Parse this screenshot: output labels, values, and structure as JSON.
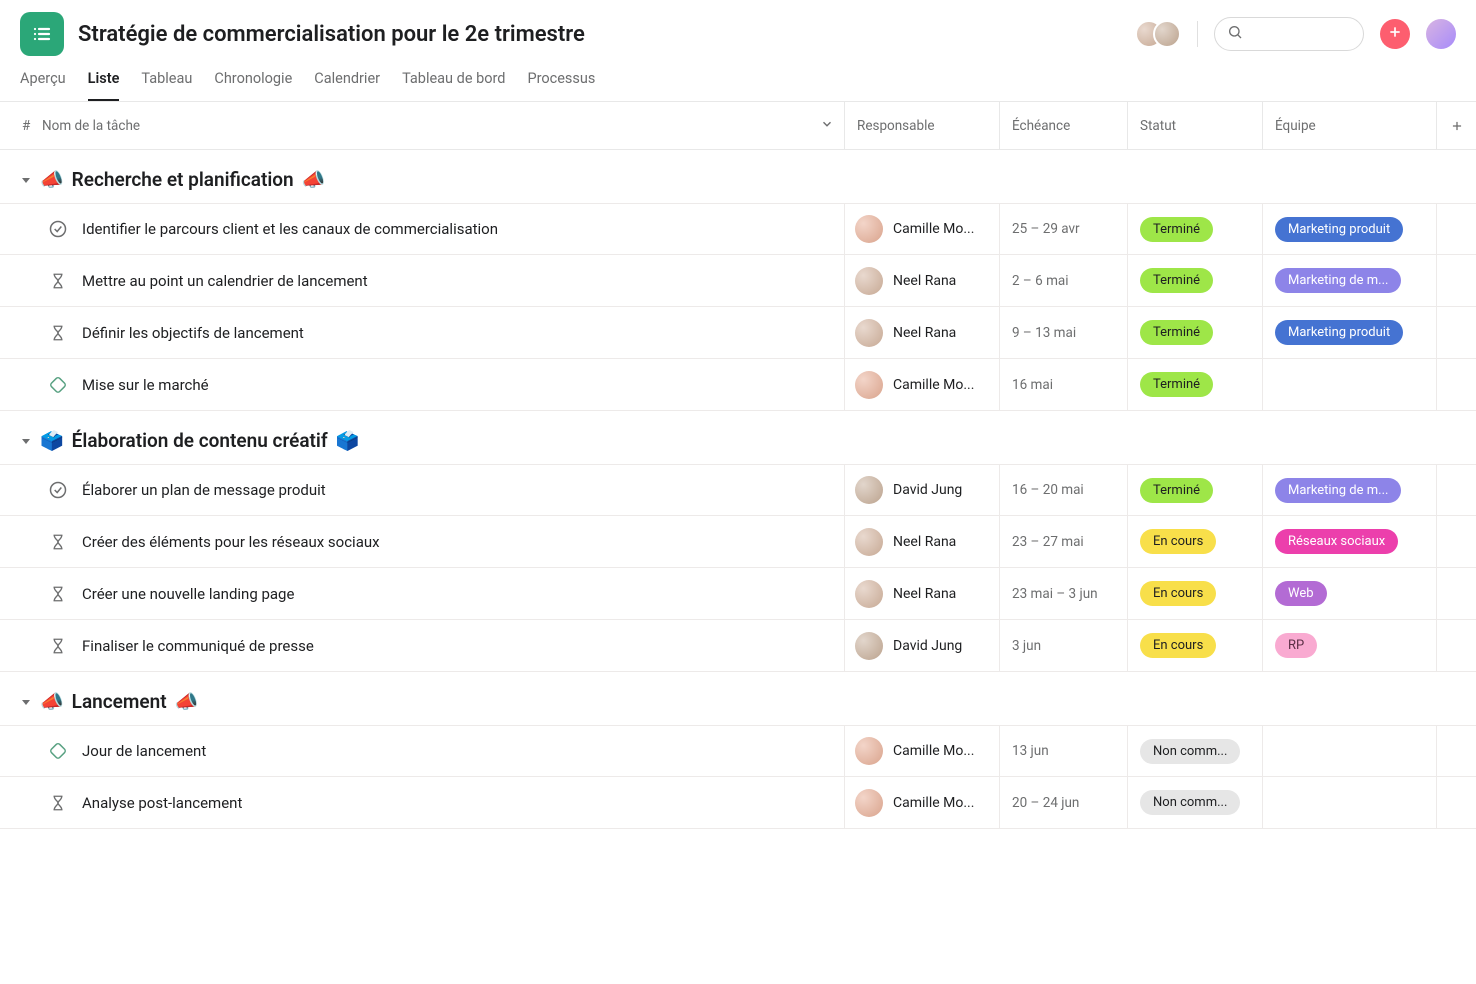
{
  "project": {
    "title": "Stratégie de commercialisation pour le 2e trimestre"
  },
  "tabs": [
    {
      "label": "Aperçu",
      "active": false
    },
    {
      "label": "Liste",
      "active": true
    },
    {
      "label": "Tableau",
      "active": false
    },
    {
      "label": "Chronologie",
      "active": false
    },
    {
      "label": "Calendrier",
      "active": false
    },
    {
      "label": "Tableau de bord",
      "active": false
    },
    {
      "label": "Processus",
      "active": false
    }
  ],
  "columns": {
    "num": "#",
    "name": "Nom de la tâche",
    "responsible": "Responsable",
    "due": "Échéance",
    "status": "Statut",
    "team": "Équipe"
  },
  "status_colors": {
    "Terminé": "#9ee648",
    "En cours": "#f8df4a",
    "Non comm...": "#e6e6e6"
  },
  "team_colors": {
    "Marketing produit": {
      "bg": "#4573D2",
      "fg": "#ffffff"
    },
    "Marketing de m...": {
      "bg": "#8d84e8",
      "fg": "#ffffff"
    },
    "Réseaux sociaux": {
      "bg": "#ec3fac",
      "fg": "#ffffff"
    },
    "Web": {
      "bg": "#b36bd4",
      "fg": "#ffffff"
    },
    "RP": {
      "bg": "#f9aad1",
      "fg": "#5a2e45"
    }
  },
  "sections": [
    {
      "title": "Recherche et planification",
      "emoji": "📣",
      "tasks": [
        {
          "icon": "check",
          "name": "Identifier le parcours client et les canaux de commercialisation",
          "assignee": "Camille Mo...",
          "aclass": "av-c",
          "due": "25 – 29 avr",
          "status": "Terminé",
          "team": "Marketing produit"
        },
        {
          "icon": "hourglass",
          "name": "Mettre au point un calendrier de lancement",
          "assignee": "Neel Rana",
          "aclass": "av-n",
          "due": "2 – 6 mai",
          "status": "Terminé",
          "team": "Marketing de m..."
        },
        {
          "icon": "hourglass",
          "name": "Définir les objectifs de lancement",
          "assignee": "Neel Rana",
          "aclass": "av-n",
          "due": "9 – 13 mai",
          "status": "Terminé",
          "team": "Marketing produit"
        },
        {
          "icon": "diamond",
          "name": "Mise sur le marché",
          "assignee": "Camille Mo...",
          "aclass": "av-c",
          "due": "16 mai",
          "status": "Terminé",
          "team": null
        }
      ]
    },
    {
      "title": "Élaboration de contenu créatif",
      "emoji": "🗳️",
      "tasks": [
        {
          "icon": "check",
          "name": "Élaborer un plan de message produit",
          "assignee": "David Jung",
          "aclass": "av-d",
          "due": "16 – 20 mai",
          "status": "Terminé",
          "team": "Marketing de m..."
        },
        {
          "icon": "hourglass",
          "name": "Créer des éléments pour les réseaux sociaux",
          "assignee": "Neel Rana",
          "aclass": "av-n",
          "due": "23 – 27 mai",
          "status": "En cours",
          "team": "Réseaux sociaux"
        },
        {
          "icon": "hourglass",
          "name": "Créer une nouvelle landing page",
          "assignee": "Neel Rana",
          "aclass": "av-n",
          "due": "23 mai – 3 jun",
          "status": "En cours",
          "team": "Web"
        },
        {
          "icon": "hourglass",
          "name": "Finaliser le communiqué de presse",
          "assignee": "David Jung",
          "aclass": "av-d",
          "due": "3 jun",
          "status": "En cours",
          "team": "RP"
        }
      ]
    },
    {
      "title": "Lancement",
      "emoji": "📣",
      "tasks": [
        {
          "icon": "diamond",
          "name": "Jour de lancement",
          "assignee": "Camille Mo...",
          "aclass": "av-c",
          "due": "13 jun",
          "status": "Non comm...",
          "team": null
        },
        {
          "icon": "hourglass",
          "name": "Analyse post-lancement",
          "assignee": "Camille Mo...",
          "aclass": "av-c",
          "due": "20 – 24 jun",
          "status": "Non comm...",
          "team": null
        }
      ]
    }
  ]
}
